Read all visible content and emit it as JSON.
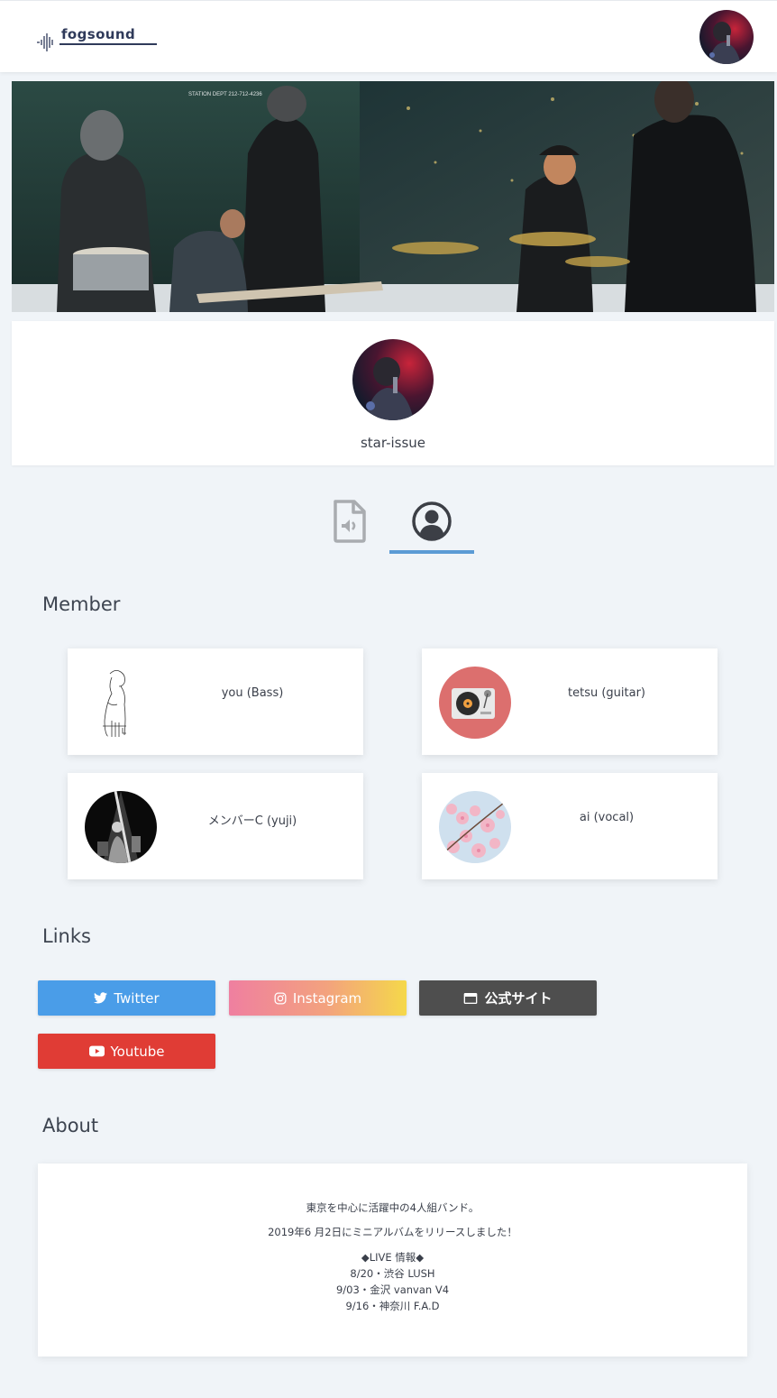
{
  "header": {
    "logo_text": "fogsound"
  },
  "profile": {
    "name": "star-issue"
  },
  "tabs": [
    {
      "name": "audio",
      "icon": "file-audio-icon",
      "active": false
    },
    {
      "name": "profile",
      "icon": "user-circle-icon",
      "active": true
    }
  ],
  "sections": {
    "member": "Member",
    "links": "Links",
    "about": "About"
  },
  "members": [
    {
      "name": "you (Bass)",
      "photo": "sketch-figure"
    },
    {
      "name": "tetsu (guitar)",
      "photo": "turntable"
    },
    {
      "name": "メンバーC (yuji)",
      "photo": "live-stage"
    },
    {
      "name": "ai (vocal)",
      "photo": "cherry-blossom"
    }
  ],
  "links": {
    "twitter": "Twitter",
    "instagram": "Instagram",
    "official": "公式サイト",
    "youtube": "Youtube"
  },
  "about": {
    "line1": "東京を中心に活躍中の4人組バンド。",
    "line2": "2019年6 月2日にミニアルバムをリリースしました！",
    "line3": "◆LIVE 情報◆",
    "line4": "8/20・渋谷 LUSH",
    "line5": "9/03・金沢 vanvan V4",
    "line6": "9/16・神奈川 F.A.D"
  },
  "colors": {
    "accent": "#5b9bd5",
    "twitter": "#4a9de8",
    "youtube": "#e03c35",
    "official": "#4e4e4e",
    "background": "#f0f4f8"
  }
}
